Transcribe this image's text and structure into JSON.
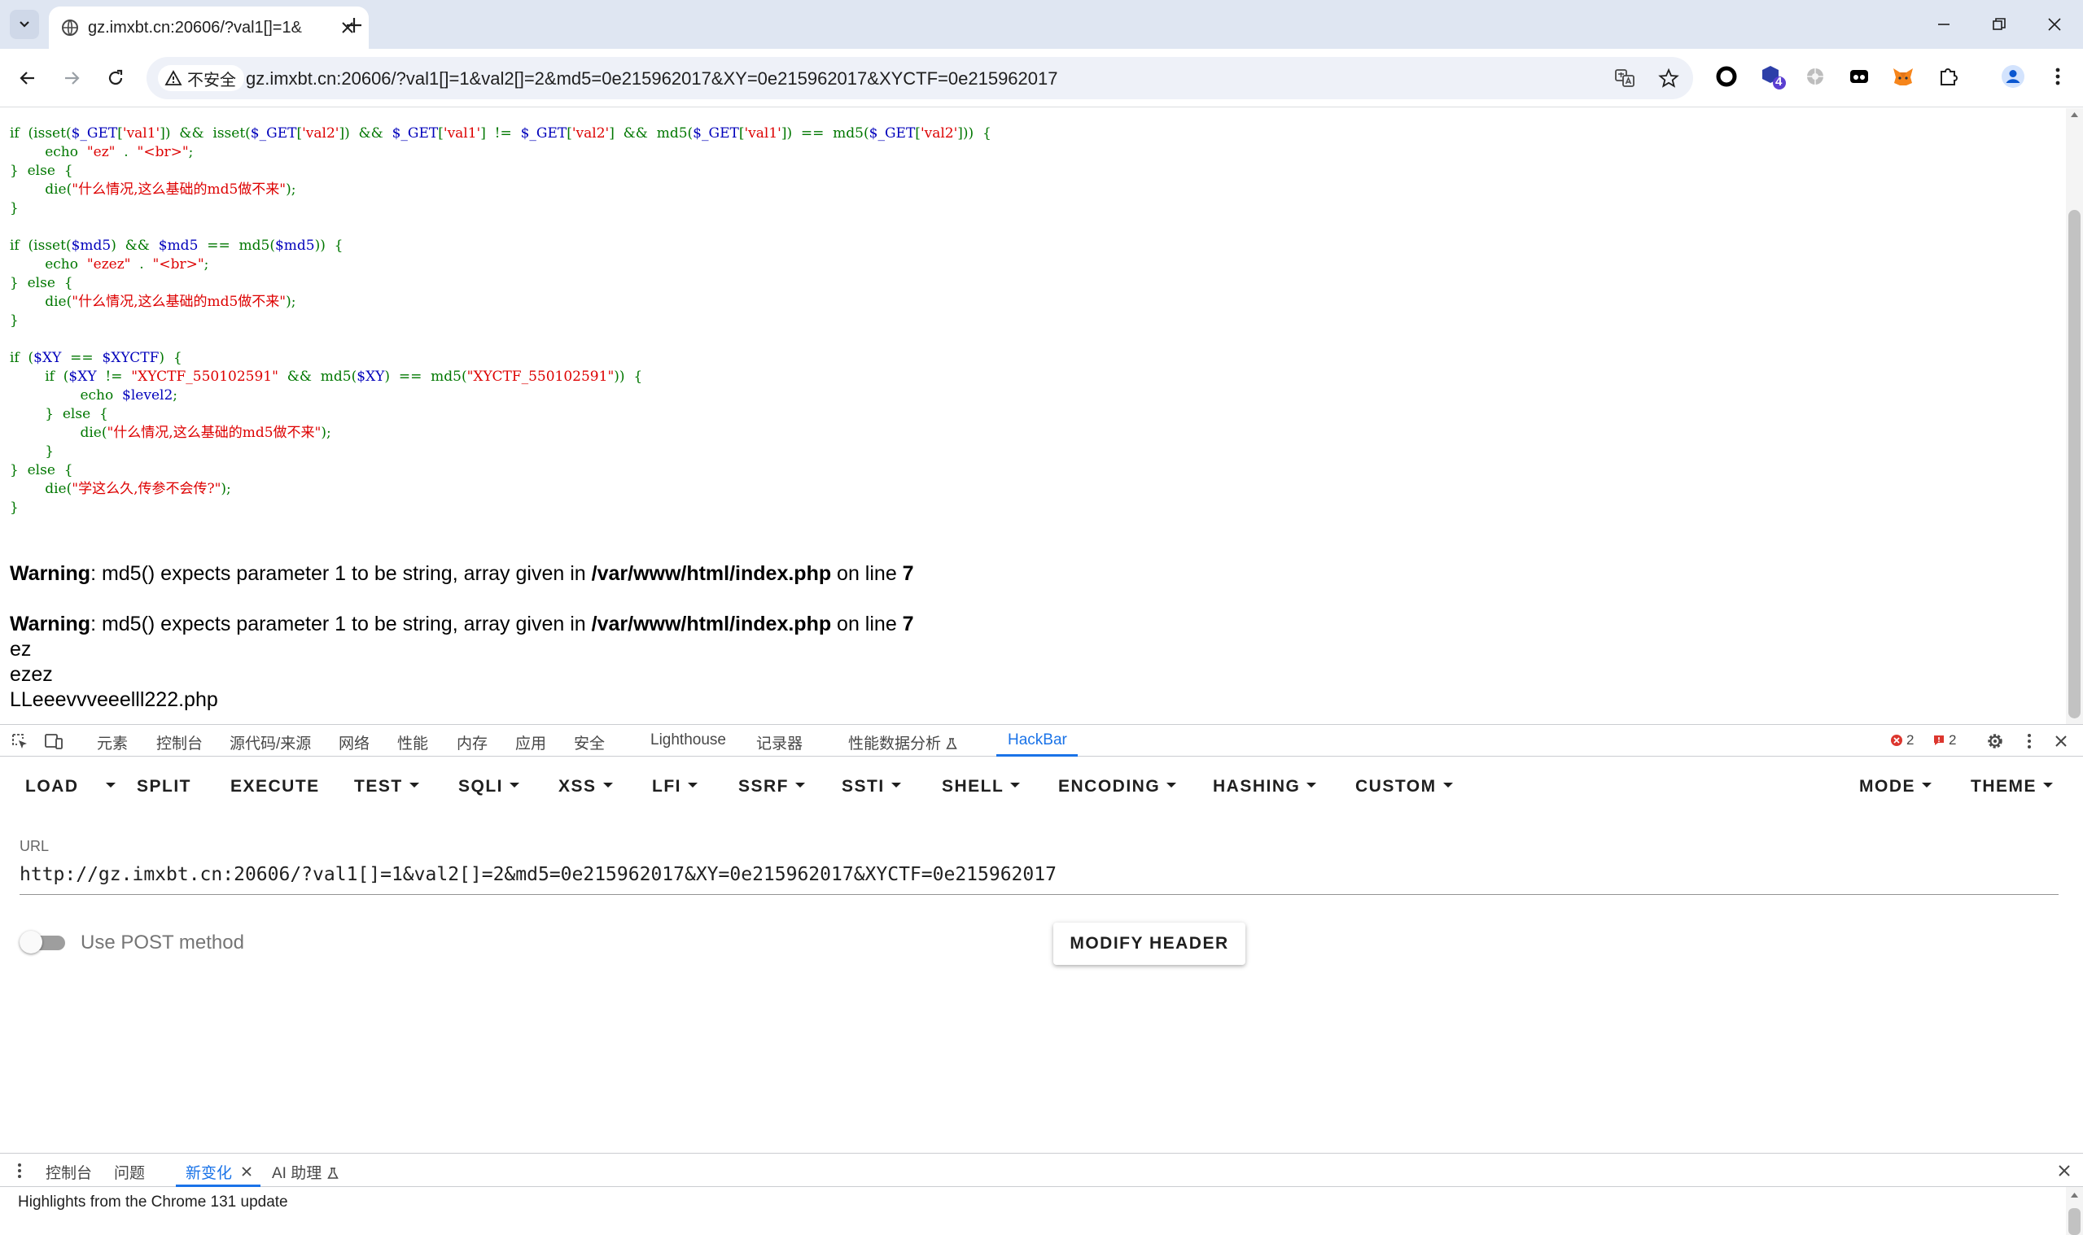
{
  "browser": {
    "tab_title": "gz.imxbt.cn:20606/?val1[]=1&",
    "insecure_label": "不安全",
    "url": "gz.imxbt.cn:20606/?val1[]=1&val2[]=2&md5=0e215962017&XY=0e215962017&XYCTF=0e215962017",
    "extension_badge": "4"
  },
  "code_lines": [
    [
      [
        "kw",
        "if  (isset("
      ],
      [
        "var",
        "$_GET"
      ],
      [
        "kw",
        "["
      ],
      [
        "str",
        "'val1'"
      ],
      [
        "kw",
        "])  &&  isset("
      ],
      [
        "var",
        "$_GET"
      ],
      [
        "kw",
        "["
      ],
      [
        "str",
        "'val2'"
      ],
      [
        "kw",
        "])  &&  "
      ],
      [
        "var",
        "$_GET"
      ],
      [
        "kw",
        "["
      ],
      [
        "str",
        "'val1'"
      ],
      [
        "kw",
        "]  !=  "
      ],
      [
        "var",
        "$_GET"
      ],
      [
        "kw",
        "["
      ],
      [
        "str",
        "'val2'"
      ],
      [
        "kw",
        "]  &&  md5("
      ],
      [
        "var",
        "$_GET"
      ],
      [
        "kw",
        "["
      ],
      [
        "str",
        "'val1'"
      ],
      [
        "kw",
        "])  ==  md5("
      ],
      [
        "var",
        "$_GET"
      ],
      [
        "kw",
        "["
      ],
      [
        "str",
        "'val2'"
      ],
      [
        "kw",
        "]))  {"
      ]
    ],
    [
      [
        "kw",
        "        echo  "
      ],
      [
        "str",
        "\"ez\""
      ],
      [
        "kw",
        "  .  "
      ],
      [
        "str",
        "\"<br>\""
      ],
      [
        "kw",
        ";"
      ]
    ],
    [
      [
        "kw",
        "}  else  {"
      ]
    ],
    [
      [
        "kw",
        "        die("
      ],
      [
        "str",
        "\"什么情况,这么基础的md5做不来\""
      ],
      [
        "kw",
        ");"
      ]
    ],
    [
      [
        "kw",
        "}"
      ]
    ],
    [
      [
        "kw",
        ""
      ]
    ],
    [
      [
        "kw",
        "if  (isset("
      ],
      [
        "var",
        "$md5"
      ],
      [
        "kw",
        ")  &&  "
      ],
      [
        "var",
        "$md5"
      ],
      [
        "kw",
        "  ==  md5("
      ],
      [
        "var",
        "$md5"
      ],
      [
        "kw",
        "))  {"
      ]
    ],
    [
      [
        "kw",
        "        echo  "
      ],
      [
        "str",
        "\"ezez\""
      ],
      [
        "kw",
        "  .  "
      ],
      [
        "str",
        "\"<br>\""
      ],
      [
        "kw",
        ";"
      ]
    ],
    [
      [
        "kw",
        "}  else  {"
      ]
    ],
    [
      [
        "kw",
        "        die("
      ],
      [
        "str",
        "\"什么情况,这么基础的md5做不来\""
      ],
      [
        "kw",
        ");"
      ]
    ],
    [
      [
        "kw",
        "}"
      ]
    ],
    [
      [
        "kw",
        ""
      ]
    ],
    [
      [
        "kw",
        "if  ("
      ],
      [
        "var",
        "$XY"
      ],
      [
        "kw",
        "  ==  "
      ],
      [
        "var",
        "$XYCTF"
      ],
      [
        "kw",
        ")  {"
      ]
    ],
    [
      [
        "kw",
        "        if  ("
      ],
      [
        "var",
        "$XY"
      ],
      [
        "kw",
        "  !=  "
      ],
      [
        "str",
        "\"XYCTF_550102591\""
      ],
      [
        "kw",
        "  &&  md5("
      ],
      [
        "var",
        "$XY"
      ],
      [
        "kw",
        ")  ==  md5("
      ],
      [
        "str",
        "\"XYCTF_550102591\""
      ],
      [
        "kw",
        "))  {"
      ]
    ],
    [
      [
        "kw",
        "                echo  "
      ],
      [
        "var",
        "$level2"
      ],
      [
        "kw",
        ";"
      ]
    ],
    [
      [
        "kw",
        "        }  else  {"
      ]
    ],
    [
      [
        "kw",
        "                die("
      ],
      [
        "str",
        "\"什么情况,这么基础的md5做不来\""
      ],
      [
        "kw",
        ");"
      ]
    ],
    [
      [
        "kw",
        "        }"
      ]
    ],
    [
      [
        "kw",
        "}  else  {"
      ]
    ],
    [
      [
        "kw",
        "        die("
      ],
      [
        "str",
        "\"学这么久,传参不会传?\""
      ],
      [
        "kw",
        ");"
      ]
    ],
    [
      [
        "kw",
        "}"
      ]
    ]
  ],
  "warnings": [
    {
      "label": "Warning",
      "message": ": md5() expects parameter 1 to be string, array given in ",
      "file": "/var/www/html/index.php",
      "on_line": " on line ",
      "line": "7"
    },
    {
      "label": "Warning",
      "message": ": md5() expects parameter 1 to be string, array given in ",
      "file": "/var/www/html/index.php",
      "on_line": " on line ",
      "line": "7"
    }
  ],
  "output_lines": [
    "ez",
    "ezez",
    "LLeeevvveeelll222.php"
  ],
  "devtools": {
    "tabs": [
      "元素",
      "控制台",
      "源代码/来源",
      "网络",
      "性能",
      "内存",
      "应用",
      "安全",
      "Lighthouse",
      "记录器",
      "性能数据分析",
      "HackBar"
    ],
    "active_tab": "HackBar",
    "error_count": "2",
    "issue_count": "2"
  },
  "hackbar": {
    "buttons": [
      "LOAD",
      "SPLIT",
      "EXECUTE",
      "TEST",
      "SQLI",
      "XSS",
      "LFI",
      "SSRF",
      "SSTI",
      "SHELL",
      "ENCODING",
      "HASHING",
      "CUSTOM",
      "MODE",
      "THEME"
    ],
    "url_label": "URL",
    "url_value": "http://gz.imxbt.cn:20606/?val1[]=1&val2[]=2&md5=0e215962017&XY=0e215962017&XYCTF=0e215962017",
    "post_label": "Use POST method",
    "post_enabled": false,
    "modify_header_label": "MODIFY HEADER"
  },
  "drawer": {
    "tabs": [
      "控制台",
      "问题",
      "新变化",
      "AI 助理"
    ],
    "active_tab": "新变化",
    "content": "Highlights from the Chrome 131 update"
  },
  "colors": {
    "keyword": "#007700",
    "variable": "#0000bb",
    "string": "#dd0000",
    "accent": "#1a73e8",
    "tabstrip": "#dfe6f2"
  }
}
